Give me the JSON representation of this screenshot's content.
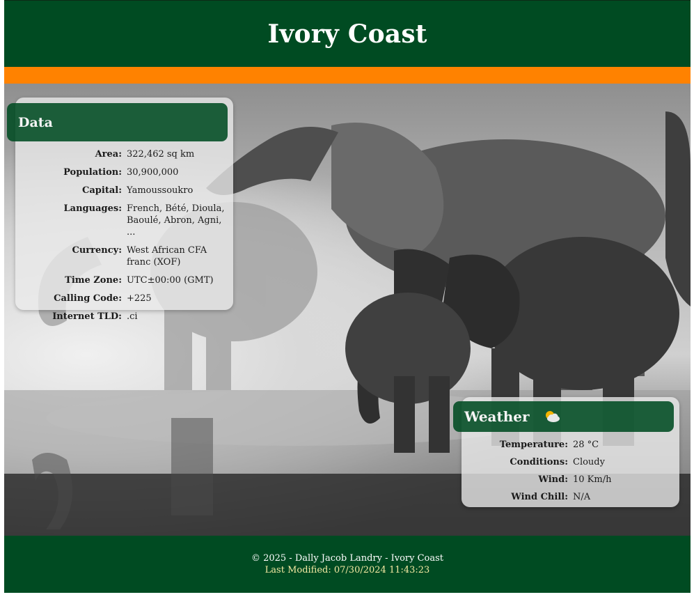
{
  "header": {
    "title": "Ivory Coast"
  },
  "colors": {
    "primary": "#004b22",
    "accent": "#ff8200",
    "footer_modified": "#f4e9a2"
  },
  "hero": {
    "image": "elephants-drinking-photo"
  },
  "data_card": {
    "title": "Data",
    "rows": [
      {
        "label": "Area:",
        "value": "322,462 sq km"
      },
      {
        "label": "Population:",
        "value": "30,900,000"
      },
      {
        "label": "Capital:",
        "value": "Yamoussoukro"
      },
      {
        "label": "Languages:",
        "value": "French, Bété, Dioula, Baoulé, Abron, Agni, ..."
      },
      {
        "label": "Currency:",
        "value": "West African CFA franc (XOF)"
      },
      {
        "label": "Time Zone:",
        "value": "UTC±00:00 (GMT)"
      },
      {
        "label": "Calling Code:",
        "value": "+225"
      },
      {
        "label": "Internet TLD:",
        "value": ".ci"
      }
    ]
  },
  "weather_card": {
    "title": "Weather",
    "icon": "partly-cloudy-icon",
    "rows": [
      {
        "label": "Temperature:",
        "value": "28 °C"
      },
      {
        "label": "Conditions:",
        "value": "Cloudy"
      },
      {
        "label": "Wind:",
        "value": "10 Km/h"
      },
      {
        "label": "Wind Chill:",
        "value": "N/A"
      }
    ]
  },
  "footer": {
    "copyright": "© 2025 - Dally Jacob Landry - Ivory Coast",
    "last_modified": "Last Modified: 07/30/2024 11:43:23"
  }
}
